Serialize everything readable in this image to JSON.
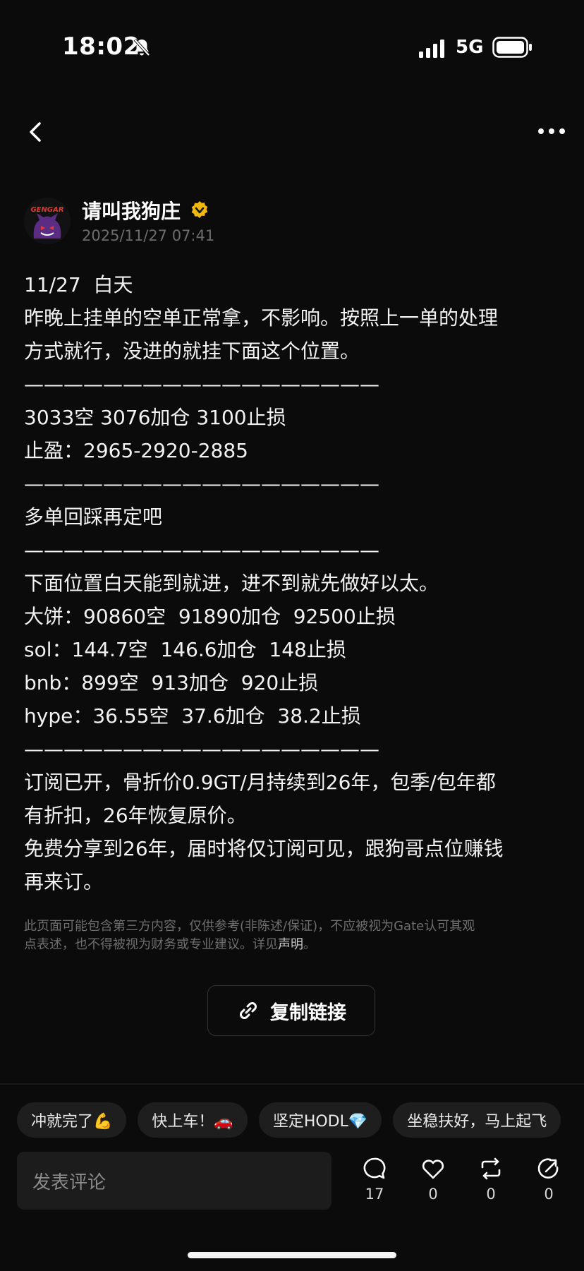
{
  "status": {
    "time": "18:02",
    "network": "5G"
  },
  "post": {
    "author": "请叫我狗庄",
    "avatar_text": "GENGAR",
    "timestamp": "2025/11/27 07:41",
    "lines": [
      "11/27  白天",
      "昨晚上挂单的空单正常拿，不影响。按照上一单的处理",
      "方式就行，没进的就挂下面这个位置。",
      "——————————————————",
      "3033空 3076加仓 3100止损",
      "止盈：2965-2920-2885",
      "——————————————————",
      "多单回踩再定吧",
      "——————————————————",
      "下面位置白天能到就进，进不到就先做好以太。",
      "大饼：90860空  91890加仓  92500止损",
      "sol：144.7空  146.6加仓  148止损",
      "bnb：899空  913加仓  920止损",
      "hype：36.55空  37.6加仓  38.2止损",
      "——————————————————",
      "订阅已开，骨折价0.9GT/月持续到26年，包季/包年都",
      "有折扣，26年恢复原价。",
      "免费分享到26年，届时将仅订阅可见，跟狗哥点位赚钱",
      "再来订。"
    ]
  },
  "disclaimer": {
    "line1": "此页面可能包含第三方内容，仅供参考(非陈述/保证)，不应被视为Gate认可其观",
    "line2": "点表述，也不得被视为财务或专业建议。详见",
    "link": "声明",
    "end": "。"
  },
  "copy_link_label": "复制链接",
  "quick_replies": [
    "冲就完了💪",
    "快上车！🚗",
    "坚定HODL💎",
    "坐稳扶好，马上起飞"
  ],
  "comment_placeholder": "发表评论",
  "actions": {
    "comments": "17",
    "likes": "0",
    "reposts": "0",
    "shares": "0"
  }
}
